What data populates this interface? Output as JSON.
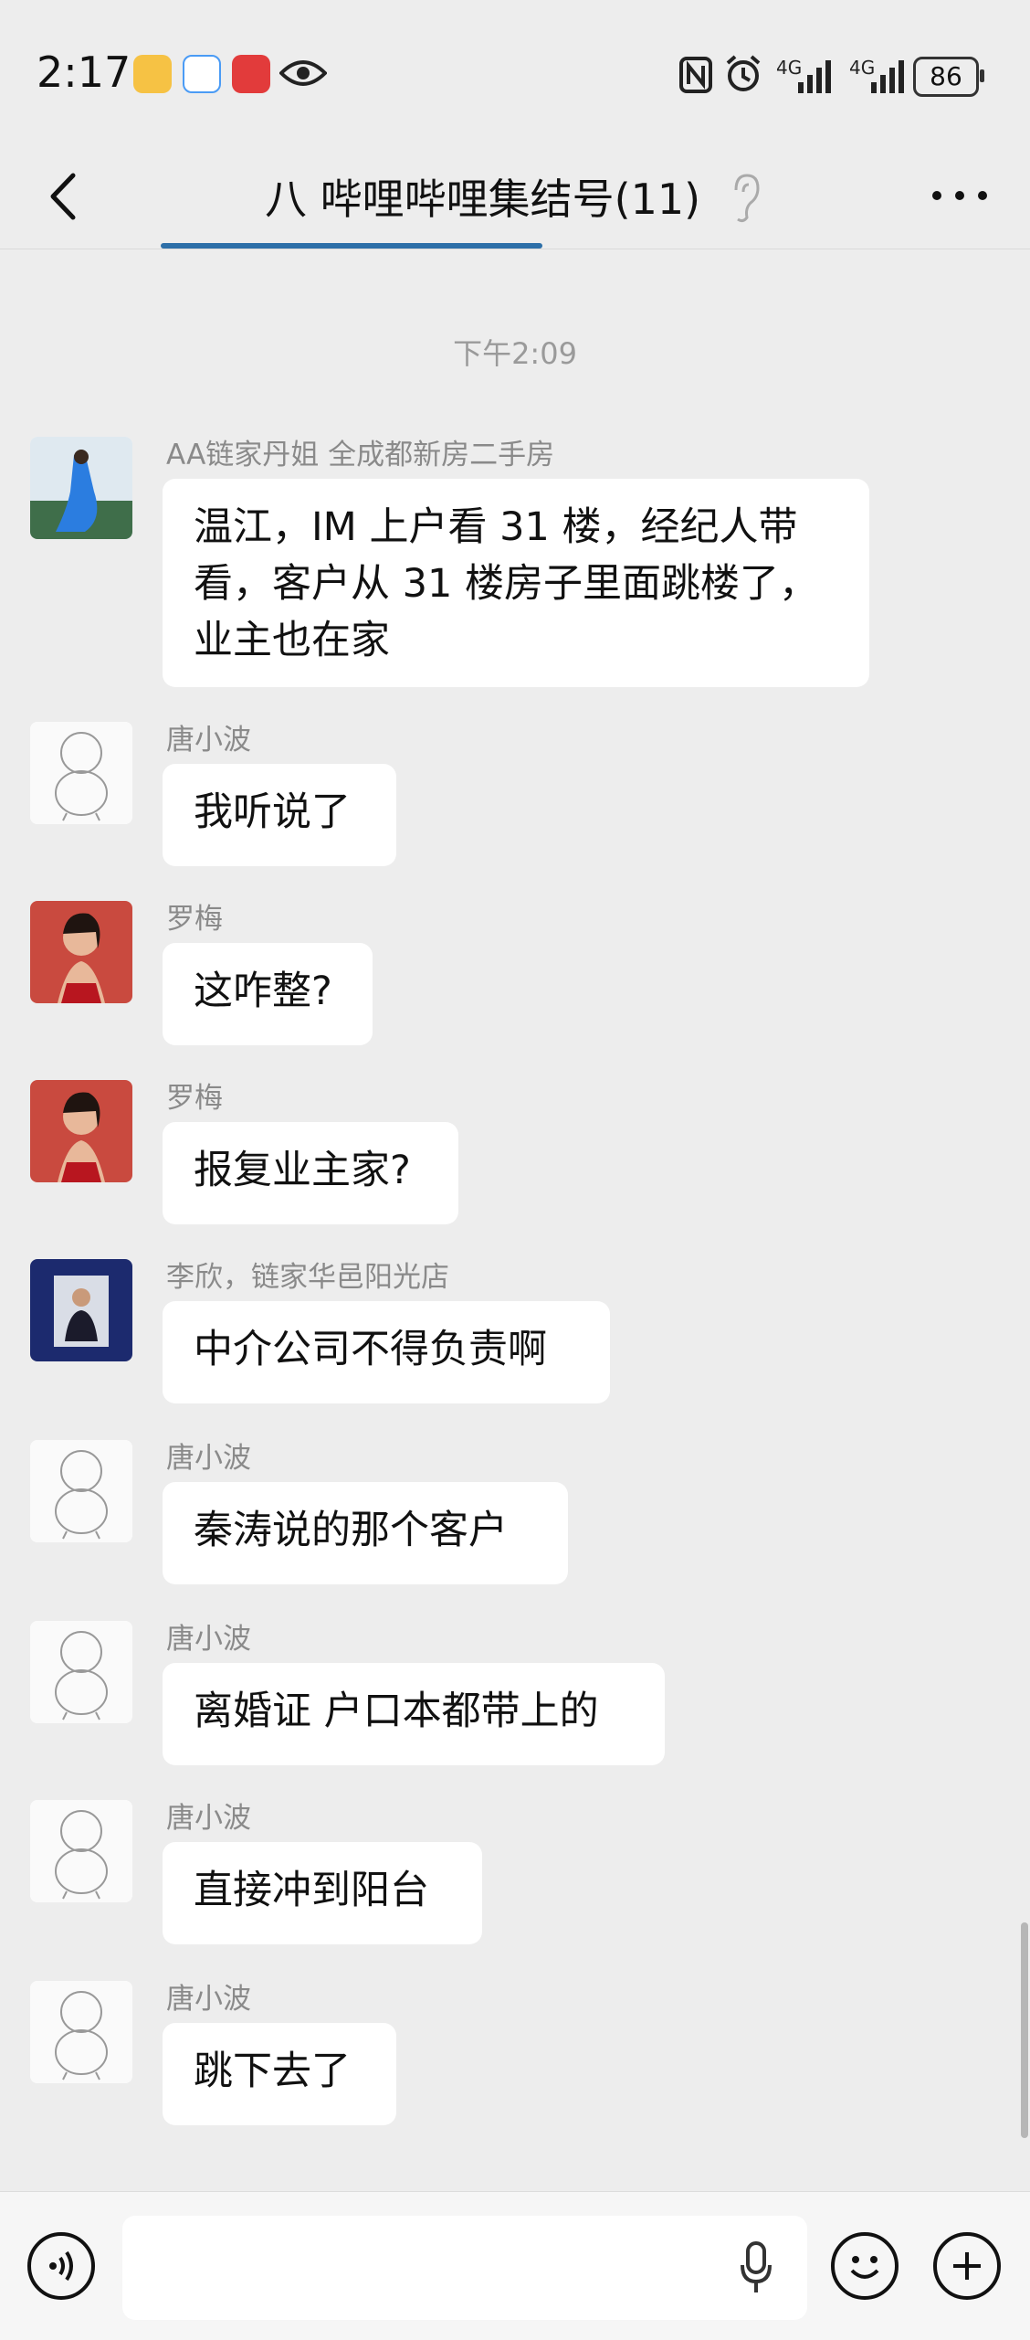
{
  "status_bar": {
    "time": "2:17",
    "network_1": "4G",
    "network_2": "4G",
    "battery": "86"
  },
  "header": {
    "title": "八 哔哩哔哩集结号(11)"
  },
  "timestamp": "下午2:09",
  "messages": [
    {
      "name": "AA链家丹姐 全成都新房二手房",
      "lines": [
        "温江，IM 上户看 31 楼，经纪人带",
        "看，客户从 31 楼房子里面跳楼了，",
        "业主也在家"
      ],
      "avatar": "photo-woman-blue-dress"
    },
    {
      "name": "唐小波",
      "lines": [
        "我听说了"
      ],
      "avatar": "sketch-cartoon"
    },
    {
      "name": "罗梅",
      "lines": [
        "这咋整?"
      ],
      "avatar": "photo-woman-red"
    },
    {
      "name": "罗梅",
      "lines": [
        "报复业主家?"
      ],
      "avatar": "photo-woman-red"
    },
    {
      "name": "李欣，链家华邑阳光店",
      "lines": [
        "中介公司不得负责啊"
      ],
      "avatar": "photo-man-suit"
    },
    {
      "name": "唐小波",
      "lines": [
        "秦涛说的那个客户"
      ],
      "avatar": "sketch-cartoon"
    },
    {
      "name": "唐小波",
      "lines": [
        "离婚证 户口本都带上的"
      ],
      "avatar": "sketch-cartoon"
    },
    {
      "name": "唐小波",
      "lines": [
        "直接冲到阳台"
      ],
      "avatar": "sketch-cartoon"
    },
    {
      "name": "唐小波",
      "lines": [
        "跳下去了"
      ],
      "avatar": "sketch-cartoon"
    }
  ],
  "input_bar": {
    "placeholder": ""
  },
  "icons": [
    "back-arrow-icon",
    "ear-icon",
    "more-icon",
    "voice-icon",
    "mic-icon",
    "emoji-icon",
    "plus-icon"
  ],
  "colors": {
    "background": "#ededed",
    "bubble": "#ffffff",
    "name_text": "#8a8a8a"
  }
}
